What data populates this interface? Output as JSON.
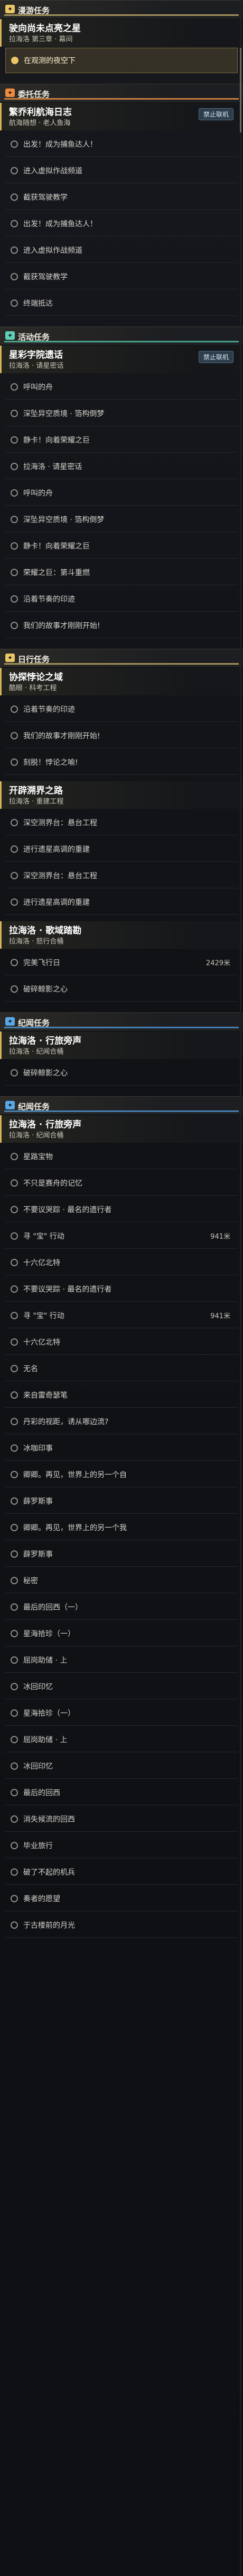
{
  "sections": [
    {
      "title": "漫游任务",
      "color": "gold",
      "cards": [
        {
          "title": "驶向尚未点亮之星",
          "sub": "拉海洛 第三章 · 幕间",
          "tag": "",
          "steps": [
            {
              "text": "在观测的夜空下",
              "hl": true
            }
          ]
        }
      ]
    },
    {
      "title": "委托任务",
      "color": "orange",
      "cards": [
        {
          "title": "繁乔利航海日志",
          "sub": "航海随想 · 老人鱼海",
          "tag": "禁止联机",
          "steps": [
            {
              "text": "出发！成为捕鱼达人！"
            },
            {
              "text": "进入虚拟作战频道"
            },
            {
              "text": "截获驾驶教学"
            },
            {
              "text": "出发！成为捕鱼达人！"
            },
            {
              "text": "进入虚拟作战频道"
            },
            {
              "text": "截获驾驶教学"
            },
            {
              "text": "终端抵达"
            }
          ]
        }
      ]
    },
    {
      "title": "活动任务",
      "color": "teal",
      "cards": [
        {
          "title": "星彩字院遗话",
          "sub": "拉海洛 · 请星密话",
          "tag": "禁止联机",
          "steps": [
            {
              "text": "呼叫的舟"
            },
            {
              "text": "深坠异空质境 · 箔构倒梦"
            },
            {
              "text": "静卡！向着荣耀之巨"
            },
            {
              "text": "拉海洛 · 请星密话"
            },
            {
              "text": "呼叫的舟"
            },
            {
              "text": "深坠异空质境 · 箔构倒梦"
            },
            {
              "text": "静卡！向着荣耀之巨"
            },
            {
              "text": "荣耀之巨：第斗重燃"
            },
            {
              "text": "沿着节奏的印迹"
            },
            {
              "text": "我们的故事才刚刚开始!"
            }
          ]
        }
      ]
    },
    {
      "title": "日行任务",
      "color": "gold",
      "cards": [
        {
          "title": "协探悖论之域",
          "sub": "酷眼 · 科考工程",
          "tag": "",
          "steps": [
            {
              "text": "沿着节奏的印迹"
            },
            {
              "text": "我们的故事才刚刚开始!"
            },
            {
              "text": "刻脱！悖论之喻!"
            }
          ]
        },
        {
          "title": "开辟溯界之路",
          "sub": "拉海洛 · 重建工程",
          "tag": "",
          "steps": [
            {
              "text": "深空测界台：悬台工程"
            },
            {
              "text": "进行遗星高调的重建"
            },
            {
              "text": "深空测界台：悬台工程"
            },
            {
              "text": "进行遗星高调的重建"
            }
          ]
        },
        {
          "title": "拉海洛 · 歌域踏勘",
          "sub": "拉海洛 · 怒行合桶",
          "tag": "",
          "steps": [
            {
              "text": "完美飞行日",
              "val": "2429米"
            },
            {
              "text": "破碎鲸影之心"
            }
          ]
        }
      ]
    },
    {
      "title": "纪闻任务",
      "color": "blue",
      "cards": [
        {
          "title": "拉海洛 · 行旅旁声",
          "sub": "拉海洛 · 纪闻合桶",
          "tag": "",
          "steps": [
            {
              "text": "破碎鲸影之心"
            }
          ]
        }
      ]
    },
    {
      "title": "纪闻任务",
      "color": "blue",
      "cards": [
        {
          "title": "拉海洛 · 行旅旁声",
          "sub": "拉海洛 · 纪闻合桶",
          "tag": "",
          "steps": [
            {
              "text": "星路宝物"
            },
            {
              "text": "不只是赛舟的记忆"
            },
            {
              "text": "不要议哭踪 · 最名的遗行者"
            },
            {
              "text": "寻 \"宝\" 行动",
              "val": "941米"
            },
            {
              "text": "十六亿北特"
            },
            {
              "text": "不要议哭踪 · 最名的遗行者"
            },
            {
              "text": "寻 \"宝\" 行动",
              "val": "941米"
            },
            {
              "text": "十六亿北特"
            },
            {
              "text": "无名"
            },
            {
              "text": "来自雷奇瑟笔"
            },
            {
              "text": "丹彩的视距，诱从哪边流?"
            },
            {
              "text": "冰咖印事"
            },
            {
              "text": "卿卿。再见，世界上的另一个自"
            },
            {
              "text": "薛罗斯事"
            },
            {
              "text": "卿卿。再见，世界上的另一个我"
            },
            {
              "text": "薛罗斯事"
            },
            {
              "text": "秘密"
            },
            {
              "text": "最后的回西（一）"
            },
            {
              "text": "星海拾珍（一）"
            },
            {
              "text": "屈岗助储 · 上"
            },
            {
              "text": "冰回印忆"
            },
            {
              "text": "星海拾珍（一）"
            },
            {
              "text": "屈岗助储 · 上"
            },
            {
              "text": "冰回印忆"
            },
            {
              "text": "最后的回西"
            },
            {
              "text": "消失候流的回西"
            },
            {
              "text": "毕业旅行"
            },
            {
              "text": "破了不起的机兵"
            },
            {
              "text": "奏者的愿望"
            },
            {
              "text": "于古楼前的月光"
            }
          ]
        }
      ]
    }
  ]
}
